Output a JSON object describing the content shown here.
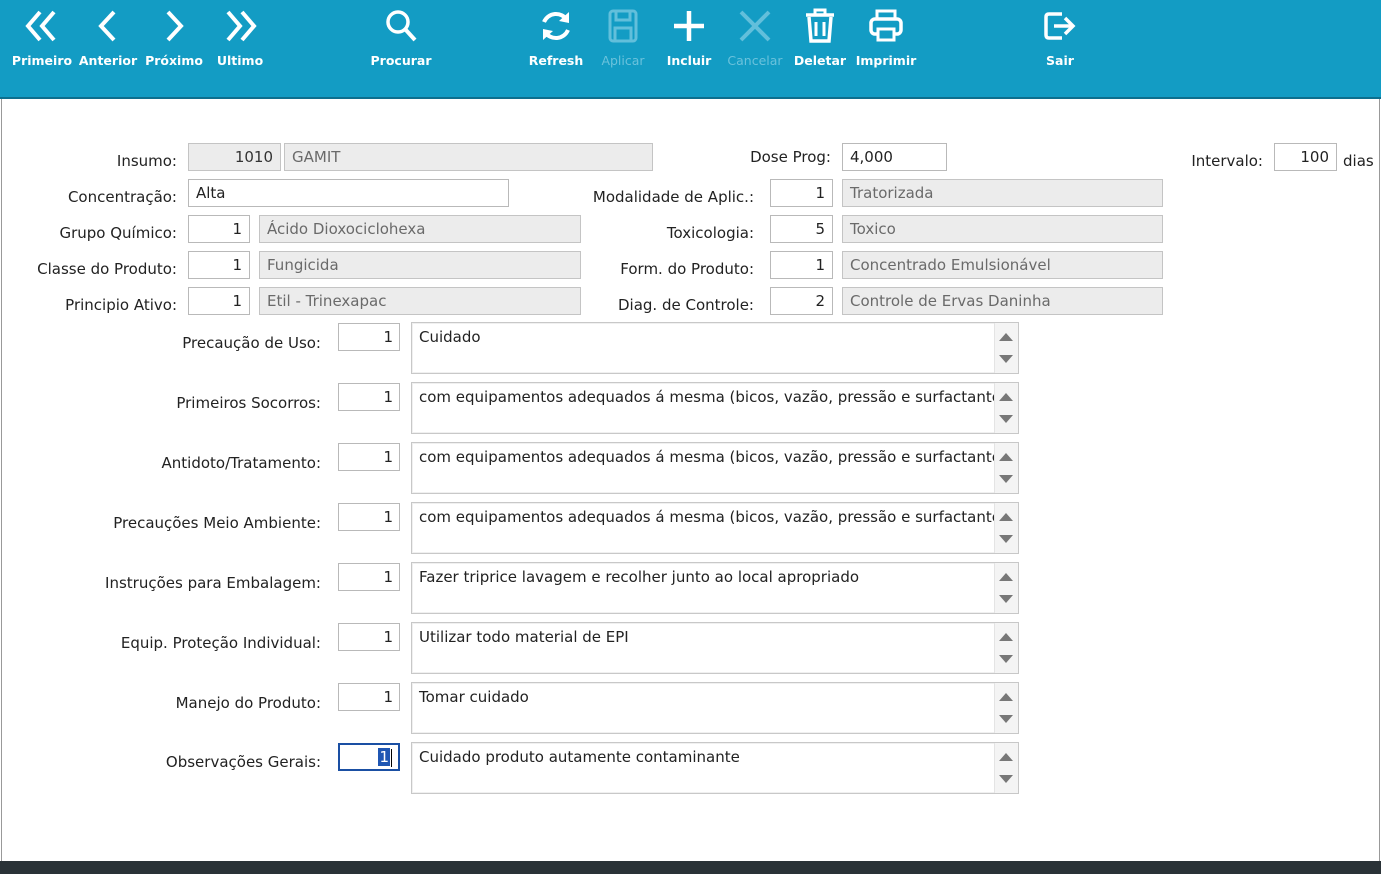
{
  "toolbar": {
    "buttons": [
      {
        "label": "Primeiro",
        "icon": "double-chevron-left-icon",
        "enabled": true
      },
      {
        "label": "Anterior",
        "icon": "chevron-left-icon",
        "enabled": true
      },
      {
        "label": "Próximo",
        "icon": "chevron-right-icon",
        "enabled": true
      },
      {
        "label": "Ultimo",
        "icon": "double-chevron-right-icon",
        "enabled": true
      },
      {
        "label": "Procurar",
        "icon": "search-icon",
        "enabled": true
      },
      {
        "label": "Refresh",
        "icon": "refresh-icon",
        "enabled": true
      },
      {
        "label": "Aplicar",
        "icon": "save-icon",
        "enabled": false
      },
      {
        "label": "Incluir",
        "icon": "plus-icon",
        "enabled": true
      },
      {
        "label": "Cancelar",
        "icon": "close-icon",
        "enabled": false
      },
      {
        "label": "Deletar",
        "icon": "trash-icon",
        "enabled": true
      },
      {
        "label": "Imprimir",
        "icon": "printer-icon",
        "enabled": true
      },
      {
        "label": "Sair",
        "icon": "exit-icon",
        "enabled": true
      }
    ],
    "color": "#139cc4"
  },
  "form": {
    "insumo": {
      "label": "Insumo:",
      "code": "1010",
      "name": "GAMIT"
    },
    "concentracao": {
      "label": "Concentração:",
      "value": "Alta"
    },
    "grupo_quimico": {
      "label": "Grupo Químico:",
      "code": "1",
      "name": "Ácido Dioxociclohexa"
    },
    "classe_produto": {
      "label": "Classe do Produto:",
      "code": "1",
      "name": "Fungicida"
    },
    "principio_ativo": {
      "label": "Principio Ativo:",
      "code": "1",
      "name": "Etil - Trinexapac"
    },
    "dose_prog": {
      "label": "Dose Prog:",
      "value": "4,000"
    },
    "modalidade": {
      "label": "Modalidade de Aplic.:",
      "code": "1",
      "name": "Tratorizada"
    },
    "toxicologia": {
      "label": "Toxicologia:",
      "code": "5",
      "name": "Toxico"
    },
    "form_produto": {
      "label": "Form. do Produto:",
      "code": "1",
      "name": "Concentrado Emulsionável"
    },
    "diag_controle": {
      "label": "Diag. de Controle:",
      "code": "2",
      "name": "Controle de Ervas Daninha"
    },
    "intervalo": {
      "label": "Intervalo:",
      "value": "100",
      "unit": "dias"
    },
    "memos": [
      {
        "label": "Precaução de Uso:",
        "code": "1",
        "text": "Cuidado"
      },
      {
        "label": "Primeiros Socorros:",
        "code": "1",
        "text": "com equipamentos adequados á mesma (bicos, vazão, pressão e surfactantes)"
      },
      {
        "label": "Antidoto/Tratamento:",
        "code": "1",
        "text": "com equipamentos adequados á mesma (bicos, vazão, pressão e surfactantes)"
      },
      {
        "label": "Precauções Meio Ambiente:",
        "code": "1",
        "text": "com equipamentos adequados á mesma (bicos, vazão, pressão e surfactantes)"
      },
      {
        "label": "Instruções para Embalagem:",
        "code": "1",
        "text": "Fazer triprice lavagem e recolher junto ao local apropriado"
      },
      {
        "label": "Equip. Proteção Individual:",
        "code": "1",
        "text": "Utilizar todo material de EPI"
      },
      {
        "label": "Manejo do Produto:",
        "code": "1",
        "text": "Tomar cuidado"
      },
      {
        "label": "Observações Gerais:",
        "code": "1",
        "text": "Cuidado produto autamente contaminante"
      }
    ]
  }
}
